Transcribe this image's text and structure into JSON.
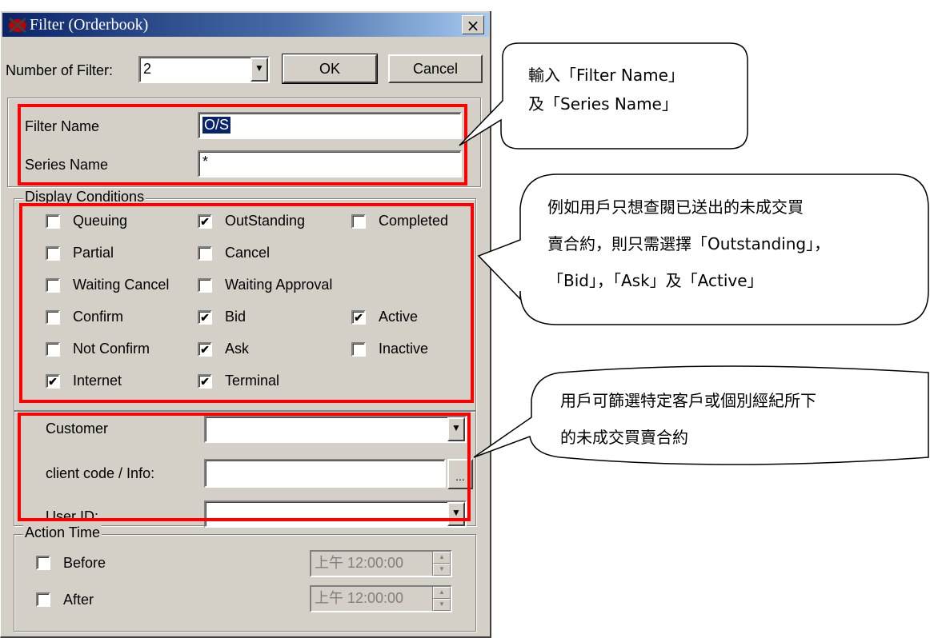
{
  "window": {
    "title": "Filter (Orderbook)",
    "close_label": "×"
  },
  "toolbar": {
    "filter_count_label": "Number of Filter:",
    "filter_count_value": "2",
    "ok_label": "OK",
    "cancel_label": "Cancel"
  },
  "names": {
    "filter_name_label": "Filter Name",
    "filter_name_value": "O/S",
    "series_name_label": "Series Name",
    "series_name_value": "*"
  },
  "display_conditions": {
    "title": "Display Conditions",
    "items": [
      {
        "label": "Queuing",
        "checked": false
      },
      {
        "label": "OutStanding",
        "checked": true
      },
      {
        "label": "Completed",
        "checked": false
      },
      {
        "label": "Partial",
        "checked": false
      },
      {
        "label": "Cancel",
        "checked": false
      },
      {
        "label": "Waiting Cancel",
        "checked": false
      },
      {
        "label": "Waiting Approval",
        "checked": false
      },
      {
        "label": "Confirm",
        "checked": false
      },
      {
        "label": "Bid",
        "checked": true
      },
      {
        "label": "Active",
        "checked": true
      },
      {
        "label": "Not Confirm",
        "checked": false
      },
      {
        "label": "Ask",
        "checked": true
      },
      {
        "label": "Inactive",
        "checked": false
      },
      {
        "label": "Internet",
        "checked": true
      },
      {
        "label": "Terminal",
        "checked": true
      }
    ]
  },
  "client": {
    "customer_label": "Customer",
    "client_code_label": "client code / Info:",
    "browse_label": "...",
    "user_id_label": "User ID:"
  },
  "action_time": {
    "title": "Action Time",
    "before_label": "Before",
    "after_label": "After",
    "before_time": "上午 12:00:00",
    "after_time": "上午 12:00:00"
  },
  "callouts": {
    "c1_line1": "輸入「Filter Name」",
    "c1_line2": "及「Series Name」",
    "c2_line1": "例如用戶只想查閱已送出的未成交買",
    "c2_line2": "賣合約，則只需選擇「Outstanding」，",
    "c2_line3": "「Bid」，「Ask」及「Active」",
    "c3_line1": "用戶可篩選特定客戶或個別經紀所下",
    "c3_line2": "的未成交買賣合約"
  },
  "colors": {
    "highlight": "#ff0000",
    "titlebar": "#0a246a",
    "dialog_bg": "#d4d0c8"
  }
}
